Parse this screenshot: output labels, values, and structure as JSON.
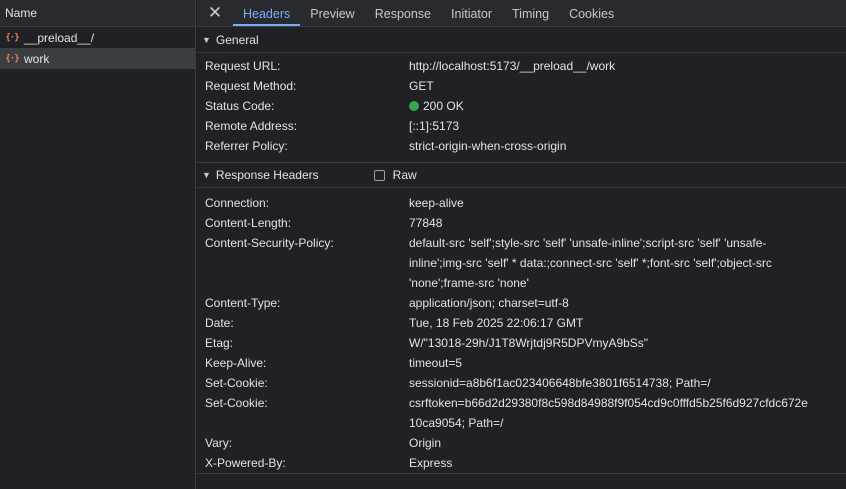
{
  "left": {
    "header": "Name",
    "requests": [
      {
        "name": "__preload__/",
        "selected": false
      },
      {
        "name": "work",
        "selected": true
      }
    ]
  },
  "tabs": {
    "close_icon": "✕",
    "items": [
      "Headers",
      "Preview",
      "Response",
      "Initiator",
      "Timing",
      "Cookies"
    ],
    "active": "Headers"
  },
  "general": {
    "title": "General",
    "rows": [
      {
        "key": "Request URL:",
        "value": "http://localhost:5173/__preload__/work"
      },
      {
        "key": "Request Method:",
        "value": "GET"
      },
      {
        "key": "Status Code:",
        "value": "200 OK"
      },
      {
        "key": "Remote Address:",
        "value": "[::1]:5173"
      },
      {
        "key": "Referrer Policy:",
        "value": "strict-origin-when-cross-origin"
      }
    ]
  },
  "response_headers": {
    "title": "Response Headers",
    "raw_label": "Raw",
    "rows": [
      {
        "key": "Connection:",
        "value": "keep-alive"
      },
      {
        "key": "Content-Length:",
        "value": "77848"
      },
      {
        "key": "Content-Security-Policy:",
        "value": "default-src 'self';style-src 'self' 'unsafe-inline';script-src 'self' 'unsafe-inline';img-src 'self' * data:;connect-src 'self' *;font-src 'self';object-src 'none';frame-src 'none'"
      },
      {
        "key": "Content-Type:",
        "value": "application/json; charset=utf-8"
      },
      {
        "key": "Date:",
        "value": "Tue, 18 Feb 2025 22:06:17 GMT"
      },
      {
        "key": "Etag:",
        "value": "W/\"13018-29h/J1T8Wrjtdj9R5DPVmyA9bSs\""
      },
      {
        "key": "Keep-Alive:",
        "value": "timeout=5"
      },
      {
        "key": "Set-Cookie:",
        "value": "sessionid=a8b6f1ac023406648bfe3801f6514738; Path=/"
      },
      {
        "key": "Set-Cookie:",
        "value": "csrftoken=b66d2d29380f8c598d84988f9f054cd9c0fffd5b25f6d927cfdc672e10ca9054; Path=/"
      },
      {
        "key": "Vary:",
        "value": "Origin"
      },
      {
        "key": "X-Powered-By:",
        "value": "Express"
      }
    ]
  },
  "colors": {
    "accent": "#7cacf8",
    "status_ok": "#35a853",
    "request_icon": "#e8845a"
  }
}
